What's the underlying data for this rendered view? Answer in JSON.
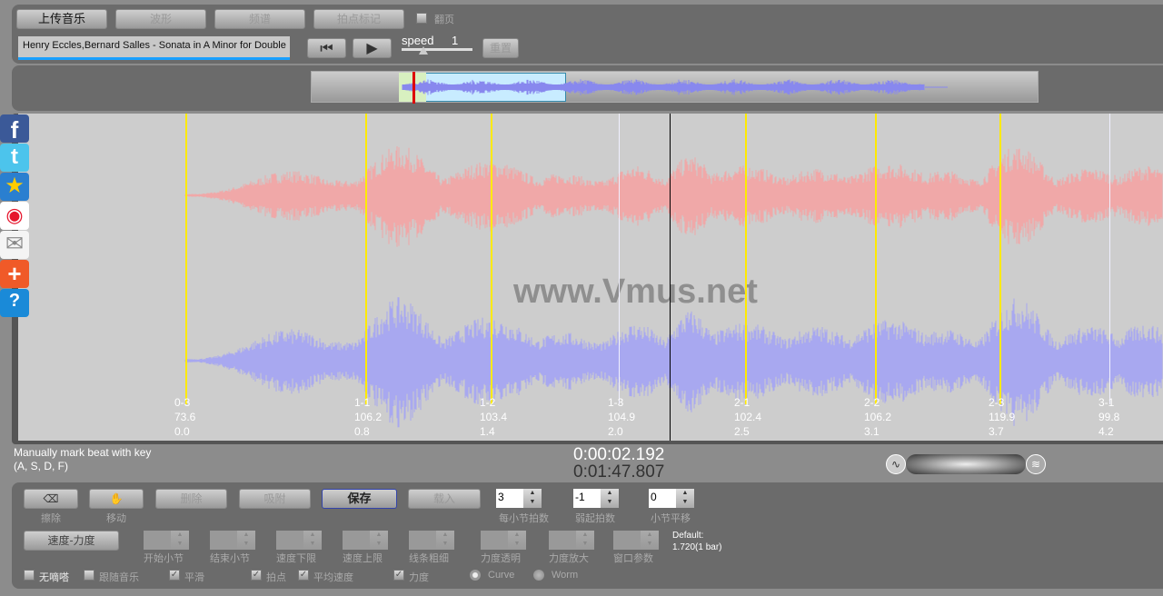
{
  "toolbar": {
    "upload": "上传音乐",
    "waveform": "波形",
    "spectrum": "频谱",
    "beat_mark": "拍点标记",
    "flip_label": "翻页"
  },
  "track": {
    "title": "Henry Eccles,Bernard Salles - Sonata in A Minor for Double"
  },
  "transport": {
    "speed_label": "speed",
    "speed_value": "1",
    "reset": "重置",
    "speed_fraction": 0.15
  },
  "watermark": "www.Vmus.net",
  "beats": [
    {
      "label": "0-3",
      "tempo": "73.6",
      "time": "0.0"
    },
    {
      "label": "1-1",
      "tempo": "106.2",
      "time": "0.8"
    },
    {
      "label": "1-2",
      "tempo": "103.4",
      "time": "1.4"
    },
    {
      "label": "1-3",
      "tempo": "104.9",
      "time": "2.0"
    },
    {
      "label": "2-1",
      "tempo": "102.4",
      "time": "2.5"
    },
    {
      "label": "2-2",
      "tempo": "106.2",
      "time": "3.1"
    },
    {
      "label": "2-3",
      "tempo": "119.9",
      "time": "3.7"
    },
    {
      "label": "3-1",
      "tempo": "99.8",
      "time": "4.2"
    }
  ],
  "hint": {
    "line1": "Manually mark beat with key",
    "line2": "(A, S, D, F)"
  },
  "time": {
    "current": "0:00:02.192",
    "total": "0:01:47.807"
  },
  "controls": {
    "erase": "擦除",
    "move": "移动",
    "delete": "删除",
    "snap": "吸附",
    "save": "保存",
    "load": "载入",
    "beats_per_bar": {
      "label": "每小节拍数",
      "value": "3"
    },
    "pickup": {
      "label": "弱起拍数",
      "value": "-1"
    },
    "bar_offset": {
      "label": "小节平移",
      "value": "0"
    },
    "tempo_dynamics": "速度-力度",
    "params": [
      "开始小节",
      "结束小节",
      "速度下限",
      "速度上限",
      "线条粗细",
      "力度透明",
      "力度放大",
      "窗口参数"
    ],
    "default_line1": "Default:",
    "default_line2": "1.720(1 bar)",
    "checks": [
      {
        "label": "无嘀嗒",
        "checked": false
      },
      {
        "label": "跟随音乐",
        "checked": false
      },
      {
        "label": "平滑",
        "checked": true
      },
      {
        "label": "拍点",
        "checked": true
      },
      {
        "label": "平均速度",
        "checked": true
      },
      {
        "label": "力度",
        "checked": true
      }
    ],
    "radios": [
      {
        "label": "Curve",
        "selected": true
      },
      {
        "label": "Worm",
        "selected": false
      }
    ]
  },
  "colors": {
    "top_channel": "#f0a8a8",
    "bottom_channel": "#a8a8f0",
    "beat_line": "#ffea00",
    "playhead": "#000000"
  }
}
